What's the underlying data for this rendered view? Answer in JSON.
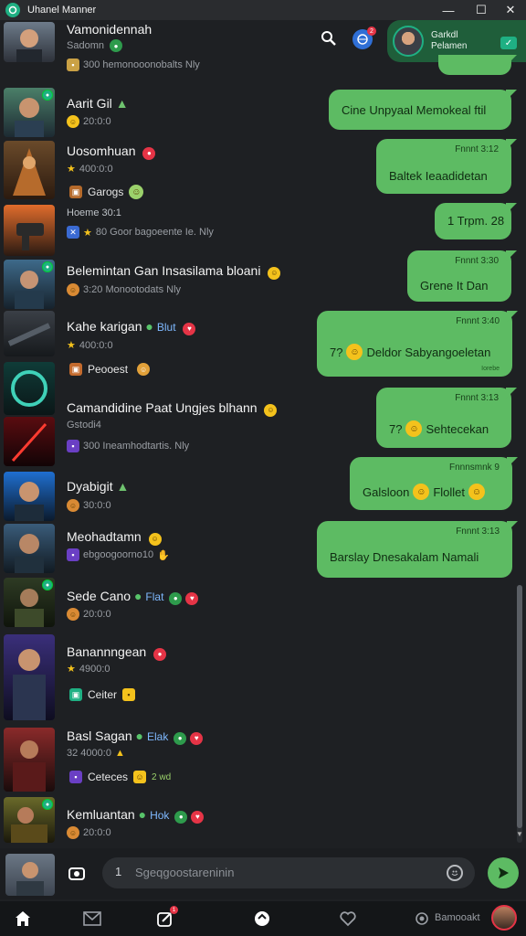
{
  "titlebar": {
    "title": "Uhanel Manner",
    "minimize": "—",
    "maximize": "☐",
    "close": "✕"
  },
  "header": {
    "call_card": {
      "line1": "Garkdl",
      "line2": "Pelamen",
      "chip": "✓"
    },
    "notif_count": "2"
  },
  "rows": [
    {
      "title": "Vamonidennah",
      "sub": "Sadomn",
      "third": "300 hemonooonobalts Nly",
      "third_icon": "IM",
      "emoji": "😐"
    },
    {
      "title": "Aarit Gil",
      "sub": "20:0:0",
      "sub_icon": "face"
    },
    {
      "title": "Uosomhuan",
      "sub": "400:0:0",
      "sub_icon": "star",
      "third": "Garogs",
      "third_icon": "box"
    },
    {
      "title": "Hoeme 30:1",
      "sub": "80 Goor bagoeente Ie. Nly",
      "sub_icon": "x"
    },
    {
      "title": "Belemintan Gan Insasilama bloani",
      "sub": "3:20 Monootodats Nly",
      "sub_icon": "face"
    },
    {
      "title": "Kahe karigan",
      "title_tag": "Blut",
      "sub": "400:0:0",
      "sub_icon": "star",
      "third": "Peooest",
      "third_icon": "box"
    },
    {
      "title": "Camandidine Paat Ungjes blhann",
      "sub": "Gstodi4",
      "third": "300 Ineamhodtartis. Nly",
      "third_icon": "IM"
    },
    {
      "title": "Dyabigit",
      "sub": "30:0:0",
      "sub_icon": "face"
    },
    {
      "title": "Meohadtamn",
      "sub": "ebgoogoorno10",
      "sub_icon": "IM"
    },
    {
      "title": "Sede Cano",
      "title_tag": "Flat",
      "sub": "20:0:0",
      "sub_icon": "face"
    },
    {
      "title": "Banannngean",
      "sub": "4900:0",
      "sub_icon": "star",
      "third": "Ceiter",
      "third_icon": "box"
    },
    {
      "title": "Basl Sagan",
      "title_tag": "Elak",
      "sub": "32 4000:0",
      "third": "Ceteces",
      "third_icon": "IM",
      "third_extra": "2 wd"
    },
    {
      "title": "Kemluantan",
      "title_tag": "Hok",
      "sub": "20:0:0",
      "sub_icon": "face"
    }
  ],
  "bubbles": [
    {
      "time": "",
      "text": "Cine Unpyaal Memokeal ftil"
    },
    {
      "time": "Fnnnt 3:12",
      "text": "Baltek Ieaadidetan"
    },
    {
      "time": "",
      "text": "1 Trpm. 28"
    },
    {
      "time": "Fnnnt 3:30",
      "text": "Grene It Dan"
    },
    {
      "time": "Fnnnt 3:40",
      "text": "Deldor Sabyangoeletan",
      "prefix": "7?",
      "small": "Iorebe"
    },
    {
      "time": "Fnnnt 3:13",
      "text": "Sehtecekan",
      "prefix": "7?"
    },
    {
      "time": "Fnnnsmnk 9",
      "text": "Galsloon",
      "text2": "Flollet"
    },
    {
      "time": "Fnnnt 3:13",
      "text": "Barslay Dnesakalam Namali"
    }
  ],
  "composer": {
    "placeholder": "Sgeqgoostareninin",
    "cursor": "1"
  },
  "nav": {
    "profile_label": "Bamooakt",
    "badge": "1"
  }
}
